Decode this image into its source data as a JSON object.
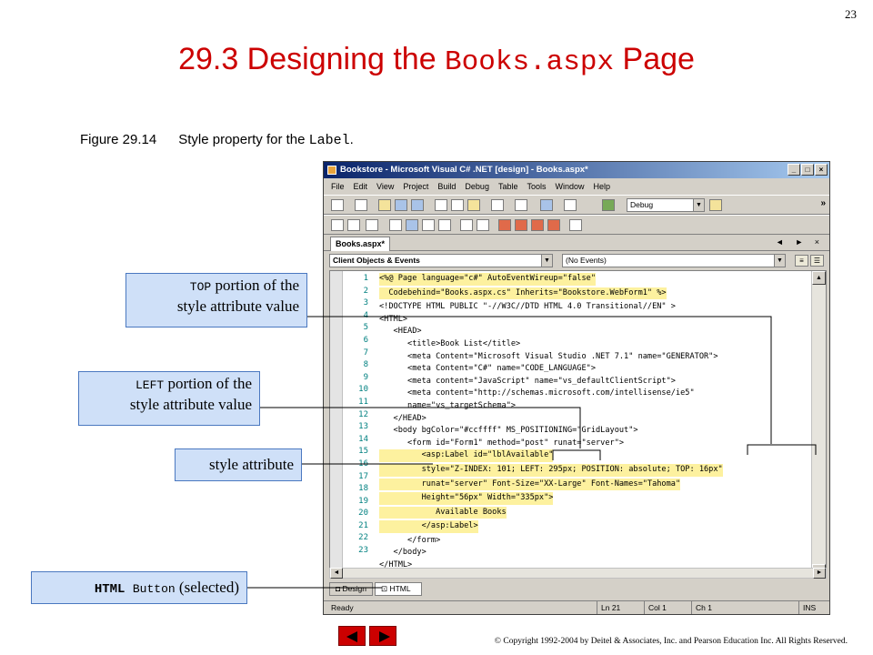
{
  "slide": {
    "page_number": "23",
    "title_prefix": "29.3  Designing the ",
    "title_mono": "Books.aspx",
    "title_suffix": " Page",
    "caption_label": "Figure 29.14",
    "caption_text": "Style property for the ",
    "caption_mono": "Label",
    "caption_end": ".",
    "copyright": "© Copyright 1992-2004 by Deitel & Associates, Inc. and Pearson Education Inc. All Rights Reserved."
  },
  "window": {
    "title": "Bookstore - Microsoft Visual C# .NET [design] - Books.aspx*",
    "btn_min": "_",
    "btn_max": "□",
    "btn_close": "×"
  },
  "menu": [
    "File",
    "Edit",
    "View",
    "Project",
    "Build",
    "Debug",
    "Table",
    "Tools",
    "Window",
    "Help"
  ],
  "toolbar": {
    "config": "Debug",
    "overflow": "»"
  },
  "doc_tab": {
    "label": "Books.aspx*",
    "controls": "◄ ► ×"
  },
  "object_combo": "Client Objects & Events",
  "event_combo": "(No Events)",
  "line_numbers": [
    "1",
    "2",
    "3",
    "4",
    "5",
    "6",
    "7",
    "8",
    "9",
    "10",
    "11",
    "12",
    "13",
    "14",
    "15",
    "16",
    "17",
    "18",
    "19",
    "20",
    "21",
    "22",
    "23"
  ],
  "code_lines": [
    "<%@ Page language=\"c#\" AutoEventWireup=\"false\"",
    "  Codebehind=\"Books.aspx.cs\" Inherits=\"Bookstore.WebForm1\" %>",
    "<!DOCTYPE HTML PUBLIC \"-//W3C//DTD HTML 4.0 Transitional//EN\" >",
    "<HTML>",
    "   <HEAD>",
    "      <title>Book List</title>",
    "      <meta Content=\"Microsoft Visual Studio .NET 7.1\" name=\"GENERATOR\">",
    "      <meta Content=\"C#\" name=\"CODE_LANGUAGE\">",
    "      <meta content=\"JavaScript\" name=\"vs_defaultClientScript\">",
    "      <meta content=\"http://schemas.microsoft.com/intellisense/ie5\"",
    "      name=\"vs_targetSchema\">",
    "   </HEAD>",
    "   <body bgColor=\"#ccffff\" MS_POSITIONING=\"GridLayout\">",
    "      <form id=\"Form1\" method=\"post\" runat=\"server\">",
    "         <asp:Label id=\"lblAvailable\"",
    "         style=\"Z-INDEX: 101; LEFT: 295px; POSITION: absolute; TOP: 16px\"",
    "         runat=\"server\" Font-Size=\"XX-Large\" Font-Names=\"Tahoma\"",
    "         Height=\"56px\" Width=\"335px\">",
    "            Available Books",
    "         </asp:Label>",
    "      </form>",
    "   </body>",
    "</HTML>"
  ],
  "view_tabs": {
    "design": "Design",
    "html": "HTML"
  },
  "status": {
    "ready": "Ready",
    "ln": "Ln 21",
    "col": "Col 1",
    "ch": "Ch 1",
    "ins": "INS"
  },
  "callouts": {
    "top_mono": "TOP",
    "top_text_1": " portion of the",
    "top_text_2": "style attribute value",
    "left_mono": "LEFT",
    "left_text_1": " portion of the",
    "left_text_2": "style attribute value",
    "style_attr": "style attribute",
    "button_bold": "HTML ",
    "button_mono": "Button",
    "button_text": " (selected)"
  },
  "colors": {
    "title_red": "#cc0000",
    "callout_fill": "#cfe0f8",
    "code_highlight": "#fdf19f"
  }
}
